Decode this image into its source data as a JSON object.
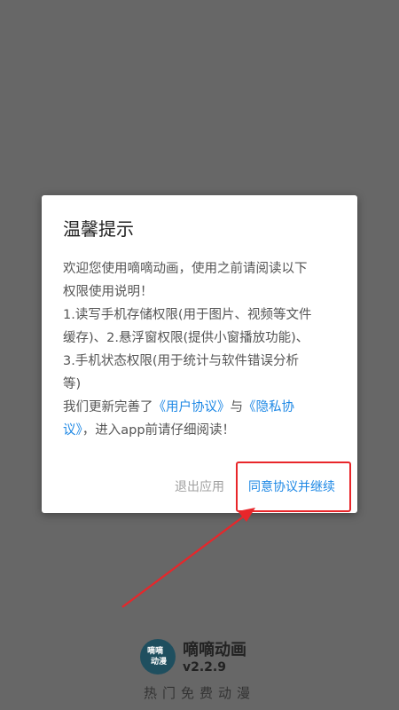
{
  "dialog": {
    "title": "温馨提示",
    "body": {
      "line1": "欢迎您使用嘀嘀动画，使用之前请阅读以下",
      "line2": "权限使用说明！",
      "line3": "1.读写手机存储权限(用于图片、视频等文件",
      "line4": "缓存)、2.悬浮窗权限(提供小窗播放功能)、",
      "line5": "3.手机状态权限(用于统计与软件错误分析",
      "line6": "等)",
      "line7_prefix": "我们更新完善了",
      "user_agreement_link": "《用户协议》",
      "line7_middle": "与",
      "privacy_link_part1": "《隐私协",
      "privacy_link_part2": "议》",
      "line8_suffix": "，进入app前请仔细阅读！"
    },
    "exit_button": "退出应用",
    "agree_button": "同意协议并继续"
  },
  "splash": {
    "logo_text_top": "嘀嘀",
    "logo_text_bottom": "动漫",
    "app_name": "嘀嘀动画",
    "version": "v2.2.9",
    "slogan": "热门免费动漫"
  },
  "colors": {
    "overlay_background": "#676767",
    "link": "#1e88e5",
    "highlight": "#e8262a"
  }
}
